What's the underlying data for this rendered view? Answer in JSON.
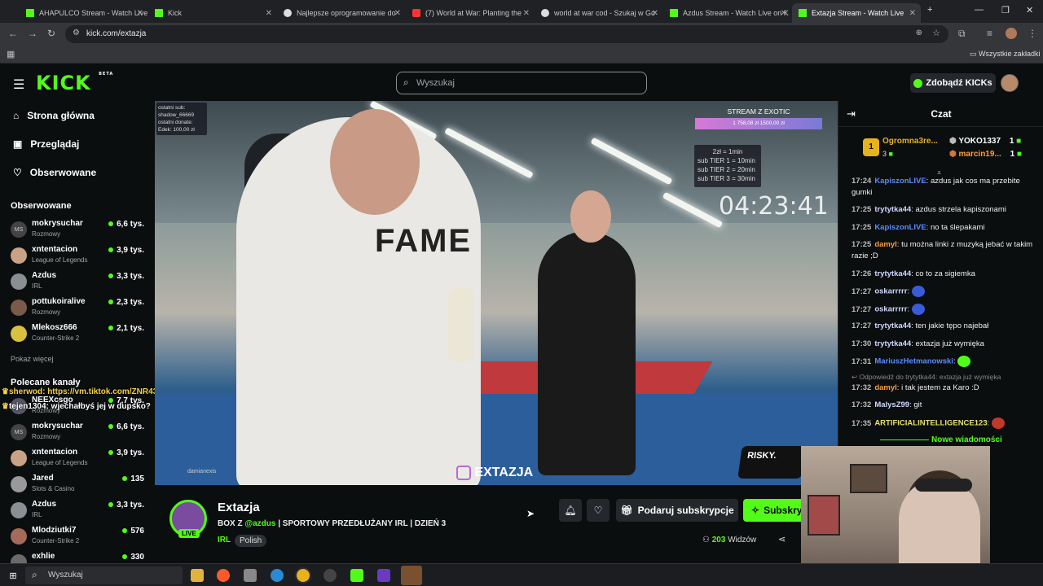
{
  "browser": {
    "tabs": [
      {
        "label": "AHAPULCO Stream - Watch Live",
        "color": "#53fc18"
      },
      {
        "label": "Kick",
        "color": "#53fc18"
      },
      {
        "label": "Najlepsze oprogramowanie do",
        "color": "#dddddd"
      },
      {
        "label": "(7) World at War: Planting the",
        "color": "#ff3333"
      },
      {
        "label": "world at war cod - Szukaj w Go",
        "color": "#dddddd"
      },
      {
        "label": "Azdus Stream - Watch Live on K",
        "color": "#53fc18"
      },
      {
        "label": "Extazja Stream - Watch Live",
        "color": "#53fc18"
      }
    ],
    "url": "kick.com/extazja",
    "bookmarks_label": "Wszystkie zakładki"
  },
  "header": {
    "search_placeholder": "Wyszukaj",
    "kicks_button": "Zdobądź KICKs",
    "logo": "KICK",
    "logo_badge": "BETA"
  },
  "sidebar": {
    "nav": [
      {
        "label": "Strona główna",
        "icon": "home-icon"
      },
      {
        "label": "Przeglądaj",
        "icon": "browse-icon"
      },
      {
        "label": "Obserwowane",
        "icon": "heart-icon"
      }
    ],
    "followed_title": "Obserwowane",
    "followed": [
      {
        "name": "mokrysuchar",
        "category": "Rozmowy",
        "viewers": "6,6 tys.",
        "avatar": "MS"
      },
      {
        "name": "xntentacion",
        "category": "League of Legends",
        "viewers": "3,9 tys.",
        "avatar": ""
      },
      {
        "name": "Azdus",
        "category": "IRL",
        "viewers": "3,3 tys.",
        "avatar": ""
      },
      {
        "name": "pottukoiralive",
        "category": "Rozmowy",
        "viewers": "2,3 tys.",
        "avatar": ""
      },
      {
        "name": "Mlekosz666",
        "category": "Counter-Strike 2",
        "viewers": "2,1 tys.",
        "avatar": ""
      }
    ],
    "show_more": "Pokaż więcej",
    "recommended_title": "Polecane kanały",
    "recommended": [
      {
        "name": "NEEXcsgo",
        "category": "Rozmowy",
        "viewers": "7,7 tys.",
        "avatar": ""
      },
      {
        "name": "mokrysuchar",
        "category": "Rozmowy",
        "viewers": "6,6 tys.",
        "avatar": "MS"
      },
      {
        "name": "xntentacion",
        "category": "League of Legends",
        "viewers": "3,9 tys.",
        "avatar": ""
      },
      {
        "name": "Jared",
        "category": "Slots & Casino",
        "viewers": "135",
        "avatar": ""
      },
      {
        "name": "Azdus",
        "category": "IRL",
        "viewers": "3,3 tys.",
        "avatar": ""
      },
      {
        "name": "Mlodziutki7",
        "category": "Counter-Strike 2",
        "viewers": "576",
        "avatar": ""
      },
      {
        "name": "exhlie",
        "category": "",
        "viewers": "330",
        "avatar": ""
      }
    ]
  },
  "video": {
    "overlay_top_left_1": "ostatni sub:",
    "overlay_top_left_2": "shadow_66669",
    "overlay_top_left_3": "ostatni donate:",
    "overlay_top_left_4": "Edek: 100,00 zł",
    "stream_goal_title": "STREAM Z EXOTIC",
    "stream_goal_values": "1 758,08 zł     1500,00 zł",
    "sub_rules": [
      "2zł = 1min",
      "sub TIER 1 = 10min",
      "sub TIER 2 = 20min",
      "sub TIER 3 = 30min"
    ],
    "timer": "04:23:41",
    "watermark": "EXTAZJA",
    "sponsor": "RISKY.",
    "overlay_chat": [
      "sherwod: https://vm.tiktok.com/ZNR43FEgT/",
      "tejen1304: wjechałbyś jej w dupsko?"
    ],
    "overlay_name": "damianexis"
  },
  "stream": {
    "streamer": "Extazja",
    "live": "LIVE",
    "title_prefix": "BOX Z ",
    "title_mention": "@azdus",
    "title_suffix": " | SPORTOWY PRZEDŁUŻANY IRL | DZIEŃ 3",
    "category": "IRL",
    "language": "Polish",
    "gift_sub": "Podaruj subskrypcje",
    "subscribe": "Subskry",
    "viewers_count": "203",
    "viewers_label": "Widzów"
  },
  "chat": {
    "title": "Czat",
    "leaders": [
      {
        "name": "Ogromna3re...",
        "count": "3"
      },
      {
        "name": "YOKO1337",
        "count": "1"
      },
      {
        "name": "marcin19...",
        "count": "1"
      }
    ],
    "messages": [
      {
        "time": "17:24",
        "user": "KapiszonLIVE",
        "color": "#5b8bff",
        "text": "azdus jak cos ma przebite gumki"
      },
      {
        "time": "17:25",
        "user": "trytytka44",
        "color": "#cfd8ff",
        "text": "azdus strzela kapiszonami"
      },
      {
        "time": "17:25",
        "user": "KapiszonLIVE",
        "color": "#5b8bff",
        "text": "no ta ślepakami"
      },
      {
        "time": "17:25",
        "user": "damyl",
        "color": "#ff9d3c",
        "text": "tu można linki z muzyką jebać w takim razie ;D"
      },
      {
        "time": "17:26",
        "user": "trytytka44",
        "color": "#cfd8ff",
        "text": "co to za sigiemka"
      },
      {
        "time": "17:27",
        "user": "oskarrrrr",
        "color": "#cfd8ff",
        "text": ""
      },
      {
        "time": "17:27",
        "user": "oskarrrrr",
        "color": "#cfd8ff",
        "text": ""
      },
      {
        "time": "17:27",
        "user": "trytytka44",
        "color": "#cfd8ff",
        "text": "ten jakie tępo najebał"
      },
      {
        "time": "17:30",
        "user": "trytytka44",
        "color": "#cfd8ff",
        "text": "extazja już wymięka"
      },
      {
        "time": "17:31",
        "user": "MariuszHetmanowski",
        "color": "#5b8bff",
        "text": ""
      },
      {
        "time": "17:32",
        "user": "damyl",
        "color": "#ff9d3c",
        "text": "i tak jestem za Karo :D"
      },
      {
        "time": "17:32",
        "user": "MalysZ99",
        "color": "#cfd8ff",
        "text": "git"
      },
      {
        "time": "17:35",
        "user": "ARTIFICIALINTELLIGENCE123",
        "color": "#e6e070",
        "text": ""
      }
    ],
    "reply_note": "Odpowiedź do trytytka44: extazja już wymięka",
    "new_messages": "Nowe wiadomości"
  },
  "taskbar": {
    "search_placeholder": "Wyszukaj"
  },
  "colors": {
    "accent": "#53fc18",
    "bg": "#0b0e0f"
  }
}
